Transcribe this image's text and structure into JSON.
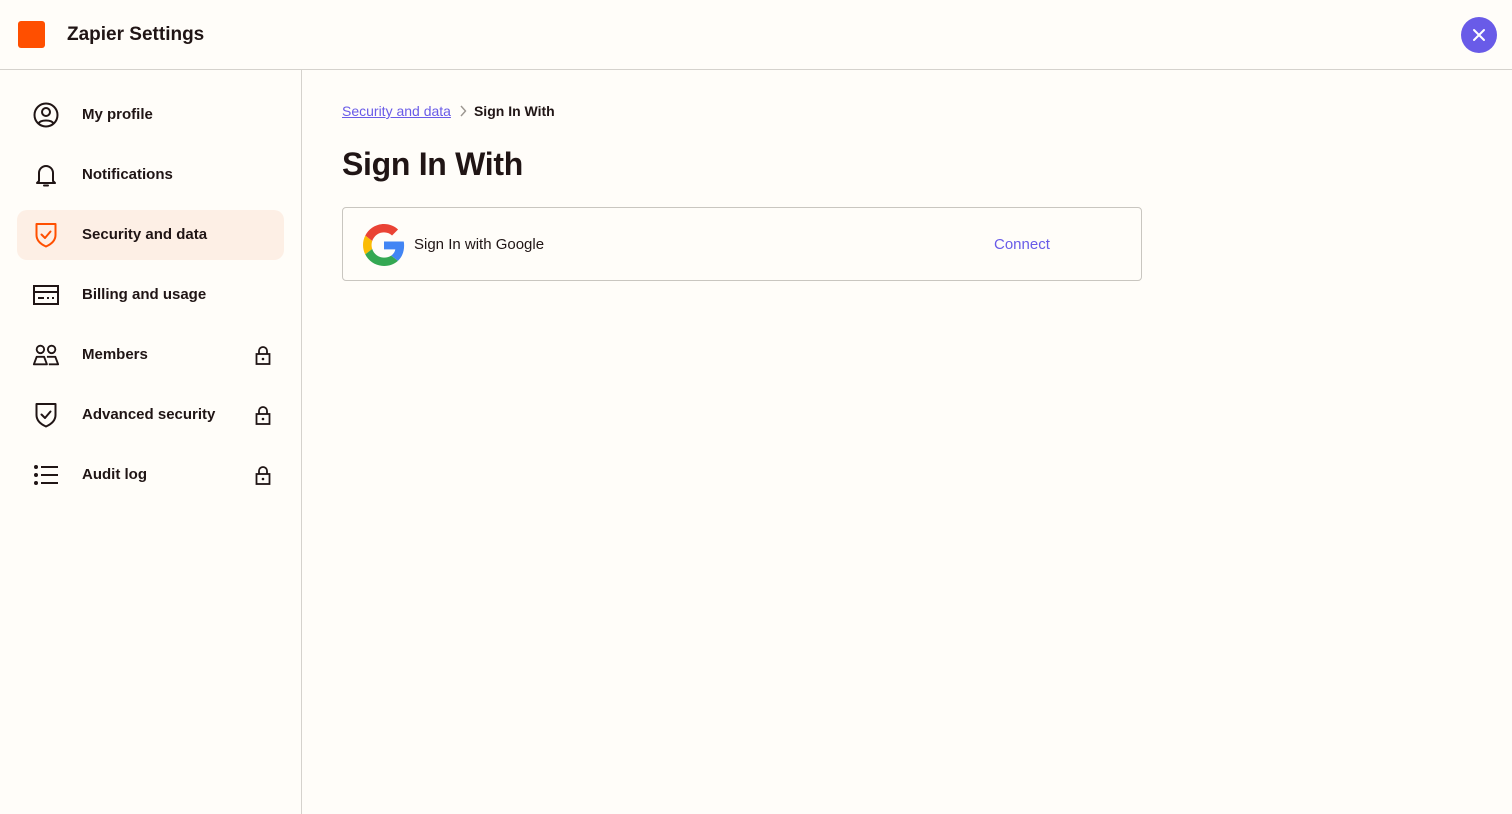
{
  "header": {
    "title": "Zapier Settings",
    "logo_color": "#ff4f00",
    "close_icon": "close-icon",
    "accent_color": "#695be8"
  },
  "sidebar": {
    "items": [
      {
        "label": "My profile",
        "icon": "user-circle-icon",
        "active": false,
        "locked": false
      },
      {
        "label": "Notifications",
        "icon": "bell-icon",
        "active": false,
        "locked": false
      },
      {
        "label": "Security and data",
        "icon": "shield-check-icon",
        "active": true,
        "locked": false
      },
      {
        "label": "Billing and usage",
        "icon": "credit-card-icon",
        "active": false,
        "locked": false
      },
      {
        "label": "Members",
        "icon": "users-icon",
        "active": false,
        "locked": true
      },
      {
        "label": "Advanced security",
        "icon": "shield-check-icon",
        "active": false,
        "locked": true
      },
      {
        "label": "Audit log",
        "icon": "list-icon",
        "active": false,
        "locked": true
      }
    ]
  },
  "main": {
    "breadcrumb": {
      "parent": "Security and data",
      "current": "Sign In With"
    },
    "title": "Sign In With",
    "providers": [
      {
        "name": "Sign In with Google",
        "icon": "google-icon",
        "action": "Connect"
      }
    ]
  }
}
